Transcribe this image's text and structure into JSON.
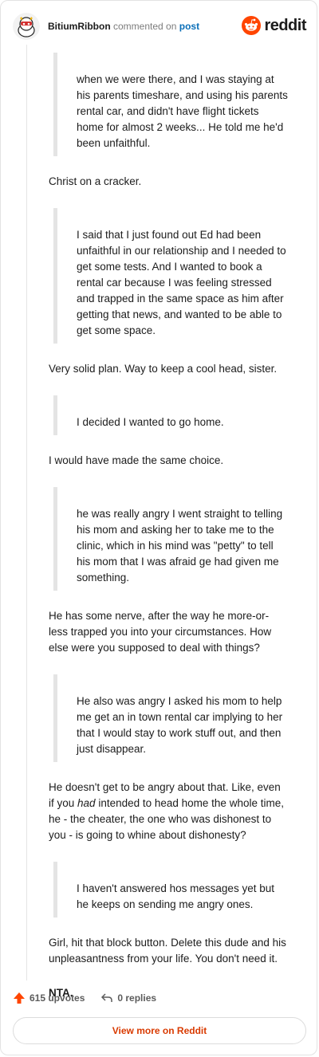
{
  "header": {
    "username": "BitiumRibbon",
    "action_text": "commented on",
    "post_link": "post",
    "logo_text": "reddit"
  },
  "comment": {
    "q1": "when we were there, and I was staying at his parents timeshare, and using his parents rental car, and didn't have flight tickets home for almost 2 weeks... He told me he'd been unfaithful.",
    "p1": "Christ on a cracker.",
    "q2": "I said that I just found out Ed had been unfaithful in our relationship and I needed to get some tests. And I wanted to book a rental car because I was feeling stressed and trapped in the same space as him after getting that news, and wanted to be able to get some space.",
    "p2": "Very solid plan. Way to keep a cool head, sister.",
    "q3": "I decided I wanted to go home.",
    "p3": "I would have made the same choice.",
    "q4": "he was really angry I went straight to telling his mom and asking her to take me to the clinic, which in his mind was \"petty\" to tell his mom that I was afraid ge had given me something.",
    "p4": "He has some nerve, after the way he more-or-less trapped you into your circumstances. How else were you supposed to deal with things?",
    "q5": "He also was angry I asked his mom to help me get an in town rental car implying to her that I would stay to work stuff out, and then just disappear.",
    "p5_before": "He doesn't get to be angry about that. Like, even if you ",
    "p5_italic": "had",
    "p5_after": " intended to head home the whole time, he - the cheater, the one who was dishonest to you - is going to whine about dishonesty?",
    "q6": "I haven't answered hos messages yet but he keeps on sending me angry ones.",
    "p6": "Girl, hit that block button. Delete this dude and his unpleasantness from your life. You don't need it.",
    "p7": "NTA."
  },
  "footer": {
    "upvotes": "615 upvotes",
    "replies": "0 replies",
    "view_more": "View more on Reddit"
  },
  "colors": {
    "accent": "#d93a00",
    "upvote": "#ff4500",
    "link": "#0a6fb8"
  }
}
